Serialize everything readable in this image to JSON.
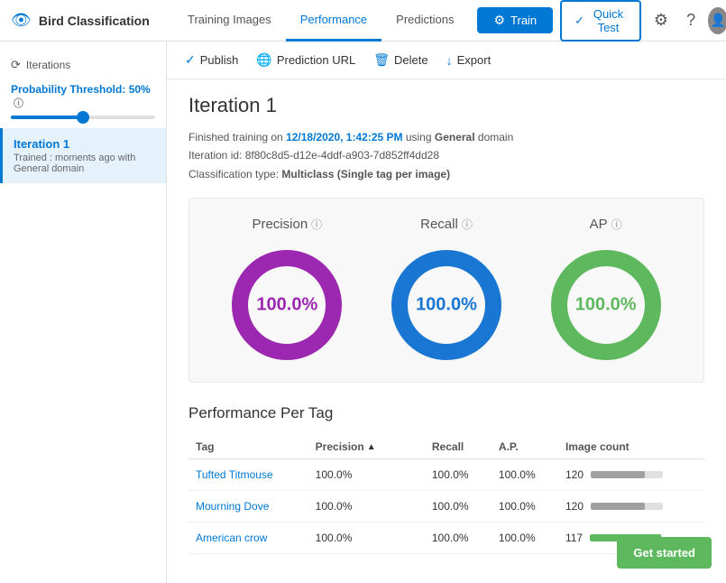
{
  "header": {
    "app_title": "Bird Classification",
    "tabs": [
      {
        "id": "training-images",
        "label": "Training Images",
        "active": false
      },
      {
        "id": "performance",
        "label": "Performance",
        "active": true
      },
      {
        "id": "predictions",
        "label": "Predictions",
        "active": false
      }
    ],
    "train_label": "Train",
    "quicktest_label": "Quick Test"
  },
  "sidebar": {
    "iterations_label": "Iterations",
    "threshold_label": "Probability Threshold:",
    "threshold_value": "50%",
    "threshold_pct": 50,
    "iteration": {
      "title": "Iteration 1",
      "subtitle": "Trained : moments ago with",
      "subtitle2": "General domain"
    }
  },
  "toolbar": {
    "publish_label": "Publish",
    "prediction_url_label": "Prediction URL",
    "delete_label": "Delete",
    "export_label": "Export"
  },
  "main": {
    "iteration_title": "Iteration 1",
    "meta": {
      "trained_date": "12/18/2020, 1:42:25 PM",
      "domain": "General",
      "iteration_id": "8f80c8d5-d12e-4ddf-a903-7d852ff4dd28",
      "classification_type": "Multiclass (Single tag per image)"
    },
    "metrics": [
      {
        "label": "Precision",
        "value": "100.0%",
        "color": "#9c27b0"
      },
      {
        "label": "Recall",
        "value": "100.0%",
        "color": "#1976d2"
      },
      {
        "label": "AP",
        "value": "100.0%",
        "color": "#5eb85e"
      }
    ],
    "perf_per_tag_title": "Performance Per Tag",
    "table_headers": [
      "Tag",
      "Precision",
      "",
      "Recall",
      "A.P.",
      "Image count"
    ],
    "table_rows": [
      {
        "tag": "Tufted Titmouse",
        "precision": "100.0%",
        "recall": "100.0%",
        "ap": "100.0%",
        "image_count": 120,
        "bar_pct": 75,
        "bar_type": "gray"
      },
      {
        "tag": "Mourning Dove",
        "precision": "100.0%",
        "recall": "100.0%",
        "ap": "100.0%",
        "image_count": 120,
        "bar_pct": 75,
        "bar_type": "gray"
      },
      {
        "tag": "American crow",
        "precision": "100.0%",
        "recall": "100.0%",
        "ap": "100.0%",
        "image_count": 117,
        "bar_pct": 98,
        "bar_type": "green"
      }
    ],
    "get_started_label": "Get started"
  }
}
